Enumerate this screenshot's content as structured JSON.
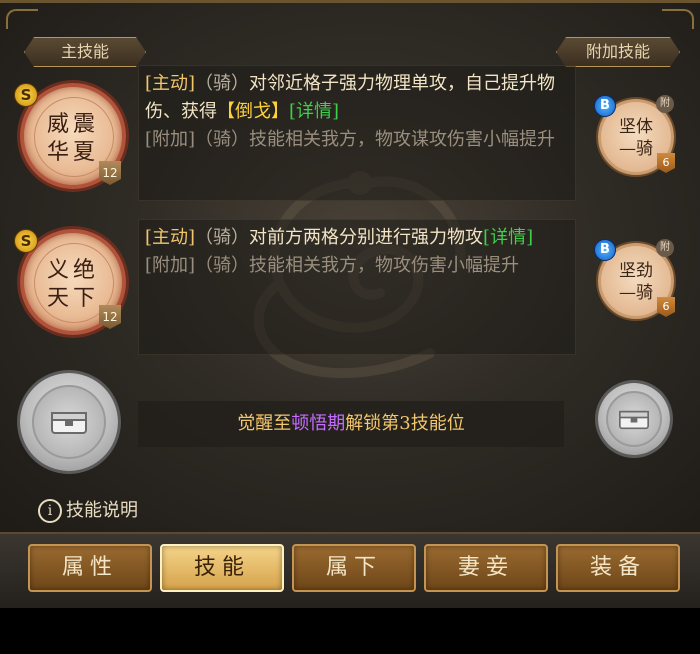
{
  "header": {
    "main_skill_tab": "主技能",
    "extra_skill_tab": "附加技能"
  },
  "skills": [
    {
      "grade": "S",
      "name": "威震\n华夏",
      "level": "12",
      "main_tag": "[主动]",
      "qi": "（骑）",
      "main_text_1": "对邻近格子强力物理单攻，自己提升物伤、获得",
      "main_highlight": "【倒戈】",
      "detail": "[详情]",
      "extra_tag": "[附加]",
      "extra_qi": "（骑）",
      "extra_text": "技能相关我方，物攻谋攻伤害小幅提升"
    },
    {
      "grade": "S",
      "name": "义绝\n天下",
      "level": "12",
      "main_tag": "[主动]",
      "qi": "（骑）",
      "main_text_1": "对前方两格分别进行强力物攻",
      "main_highlight": "",
      "detail": "[详情]",
      "extra_tag": "[附加]",
      "extra_qi": "（骑）",
      "extra_text": "技能相关我方，物攻伤害小幅提升"
    }
  ],
  "extra_skills": [
    {
      "grade": "B",
      "name": "坚体\n—骑",
      "level": "6",
      "tag": "附"
    },
    {
      "grade": "B",
      "name": "坚劲\n—骑",
      "level": "6",
      "tag": "附"
    }
  ],
  "unlock": {
    "prefix": "觉醒至",
    "stage": "顿悟期",
    "suffix": "解锁第3技能位"
  },
  "info": {
    "icon_glyph": "i",
    "label": "技能说明"
  },
  "nav": [
    "属性",
    "技能",
    "属下",
    "妻妾",
    "装备"
  ],
  "nav_active": "技能"
}
